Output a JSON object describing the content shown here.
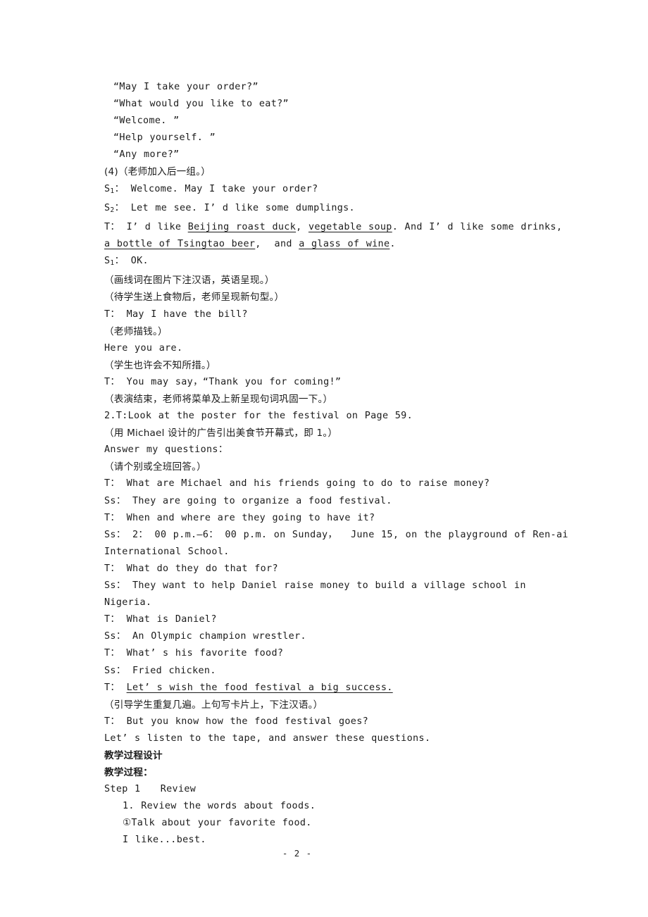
{
  "document": {
    "page_label": "- 2 -",
    "lines": [
      {
        "id": "l01",
        "style": "quoted",
        "lang": "en",
        "text": "“May I take your order?”"
      },
      {
        "id": "l02",
        "style": "quoted",
        "lang": "en",
        "text": "“What would you like to eat?”"
      },
      {
        "id": "l03",
        "style": "quoted",
        "lang": "en",
        "text": "“Welcome. ”"
      },
      {
        "id": "l04",
        "style": "quoted",
        "lang": "en",
        "text": "“Help yourself. ”"
      },
      {
        "id": "l05",
        "style": "quoted",
        "lang": "en",
        "text": "“Any more?”"
      },
      {
        "id": "l06",
        "style": "plain",
        "lang": "cn",
        "text": "(4)（老师加入后一组。）"
      },
      {
        "id": "l07",
        "style": "plain",
        "lang": "en",
        "text": "S1： Welcome. May I take your order?"
      },
      {
        "id": "l08",
        "style": "plain",
        "lang": "en",
        "text": "S2： Let me see. I’ d like some dumplings."
      },
      {
        "id": "l09",
        "style": "plain",
        "lang": "en",
        "text": "T： I’ d like Beijing roast duck, vegetable soup. And I’ d like some drinks, a bottle of Tsingtao beer,  and a glass of wine."
      },
      {
        "id": "l10",
        "style": "plain",
        "lang": "en",
        "text": "S1： OK."
      },
      {
        "id": "l11",
        "style": "plain",
        "lang": "cn",
        "text": "（画线词在图片下注汉语，英语呈现。）"
      },
      {
        "id": "l12",
        "style": "plain",
        "lang": "cn",
        "text": "（待学生送上食物后，老师呈现新句型。）"
      },
      {
        "id": "l13",
        "style": "plain",
        "lang": "en",
        "text": "T： May I have the bill?"
      },
      {
        "id": "l14",
        "style": "plain",
        "lang": "cn",
        "text": "（老师描钱。）"
      },
      {
        "id": "l15",
        "style": "plain",
        "lang": "en",
        "text": "Here you are."
      },
      {
        "id": "l16",
        "style": "plain",
        "lang": "cn",
        "text": "（学生也许会不知所措。）"
      },
      {
        "id": "l17",
        "style": "plain",
        "lang": "en",
        "text": "T： You may say，“Thank you for coming!”"
      },
      {
        "id": "l18",
        "style": "plain",
        "lang": "cn",
        "text": "（表演结束，老师将菜单及上新呈现句词巩固一下。）"
      },
      {
        "id": "l19",
        "style": "plain",
        "lang": "en",
        "text": "2.T:Look at the poster for the festival on Page 59."
      },
      {
        "id": "l20",
        "style": "plain",
        "lang": "cn",
        "text": "（用 Michael 设计的广告引出美食节开幕式，即 1。）"
      },
      {
        "id": "l21",
        "style": "plain",
        "lang": "en",
        "text": "Answer my questions："
      },
      {
        "id": "l22",
        "style": "plain",
        "lang": "cn",
        "text": "（请个别或全班回答。）"
      },
      {
        "id": "l23",
        "style": "plain",
        "lang": "en",
        "text": "T： What are Michael and his friends going to do to raise money?"
      },
      {
        "id": "l24",
        "style": "plain",
        "lang": "en",
        "text": "Ss： They are going to organize a food festival."
      },
      {
        "id": "l25",
        "style": "plain",
        "lang": "en",
        "text": "T： When and where are they going to have it?"
      },
      {
        "id": "l26",
        "style": "plain",
        "lang": "en",
        "text": "Ss： 2： 00 p.m.–6： 00 p.m. on Sunday，  June 15, on the playground of Ren-ai International School."
      },
      {
        "id": "l27",
        "style": "plain",
        "lang": "en",
        "text": "T： What do they do that for?"
      },
      {
        "id": "l28",
        "style": "plain",
        "lang": "en",
        "text": "Ss： They want to help Daniel raise money to build a village school in Nigeria."
      },
      {
        "id": "l29",
        "style": "plain",
        "lang": "en",
        "text": "T： What is Daniel?"
      },
      {
        "id": "l30",
        "style": "plain",
        "lang": "en",
        "text": "Ss： An Olympic champion wrestler."
      },
      {
        "id": "l31",
        "style": "plain",
        "lang": "en",
        "text": "T： What’ s his favorite food?"
      },
      {
        "id": "l32",
        "style": "plain",
        "lang": "en",
        "text": "Ss： Fried chicken."
      },
      {
        "id": "l33",
        "style": "plain",
        "lang": "en",
        "text": "T： Let’ s wish the food festival a big success."
      },
      {
        "id": "l34",
        "style": "plain",
        "lang": "cn",
        "text": "（引导学生重复几遍。上句写卡片上，下注汉语。）"
      },
      {
        "id": "l35",
        "style": "plain",
        "lang": "en",
        "text": "T： But you know how the food festival goes?"
      },
      {
        "id": "l36",
        "style": "plain",
        "lang": "en",
        "text": "Let’ s listen to the tape, and answer these questions."
      },
      {
        "id": "l37",
        "style": "plain",
        "lang": "cnbold",
        "text": "教学过程设计"
      },
      {
        "id": "l38",
        "style": "plain",
        "lang": "cnbold",
        "text": "教学过程："
      },
      {
        "id": "l39",
        "style": "plain",
        "lang": "en",
        "text": "Step 1   Review"
      },
      {
        "id": "l40",
        "style": "indent2",
        "lang": "en",
        "text": "1. Review the words about foods."
      },
      {
        "id": "l41",
        "style": "indent2",
        "lang": "en",
        "text": "①Talk about your favorite food."
      },
      {
        "id": "l42",
        "style": "indent2",
        "lang": "en",
        "text": "I like...best."
      }
    ],
    "rich": {
      "l07_prefix": "S",
      "l07_sub": "1",
      "l07_rest": "： Welcome. May I take your order?",
      "l08_prefix": "S",
      "l08_sub": "2",
      "l08_rest": "： Let me see. I’ d like some dumplings.",
      "l10_prefix": "S",
      "l10_sub": "1",
      "l10_rest": "： OK.",
      "l09_a": "T： I’ d like ",
      "l09_u1": "Beijing roast duck",
      "l09_b": ", ",
      "l09_u2": "vegetable soup",
      "l09_c": ". And I’ d like some drinks, ",
      "l09_u3": "a bottle of Tsingtao beer",
      "l09_d": ",  and ",
      "l09_u4": "a glass of wine",
      "l09_e": ".",
      "l33_a": "T： ",
      "l33_u": "Let’ s wish the food festival a big success."
    }
  }
}
